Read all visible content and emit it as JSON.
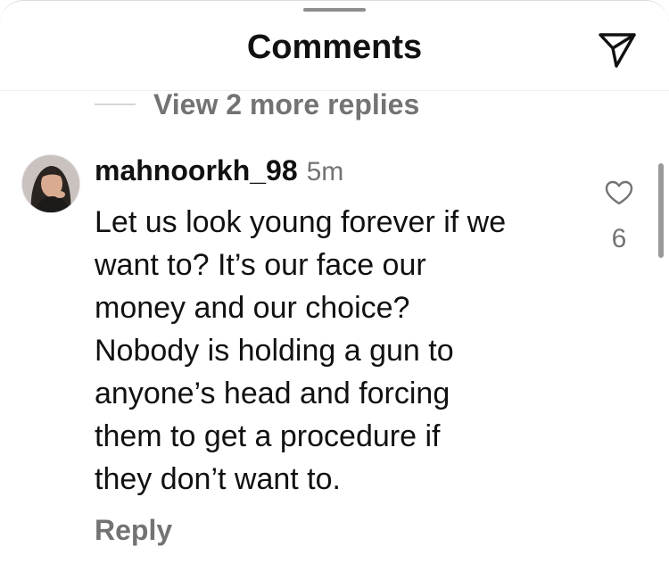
{
  "header": {
    "title": "Comments",
    "send_icon": "paper-plane-icon"
  },
  "thread": {
    "view_more_replies": "View 2 more replies"
  },
  "comment": {
    "username": "mahnoorkh_98",
    "time": "5m",
    "text": "Let us look young forever if we\nwant to? It’s our face our\nmoney and our choice?\nNobody is holding a gun to\nanyone’s head and forcing\nthem to get a procedure if\nthey don’t want to.",
    "reply_label": "Reply",
    "like_icon": "heart-icon",
    "like_count": "6"
  }
}
